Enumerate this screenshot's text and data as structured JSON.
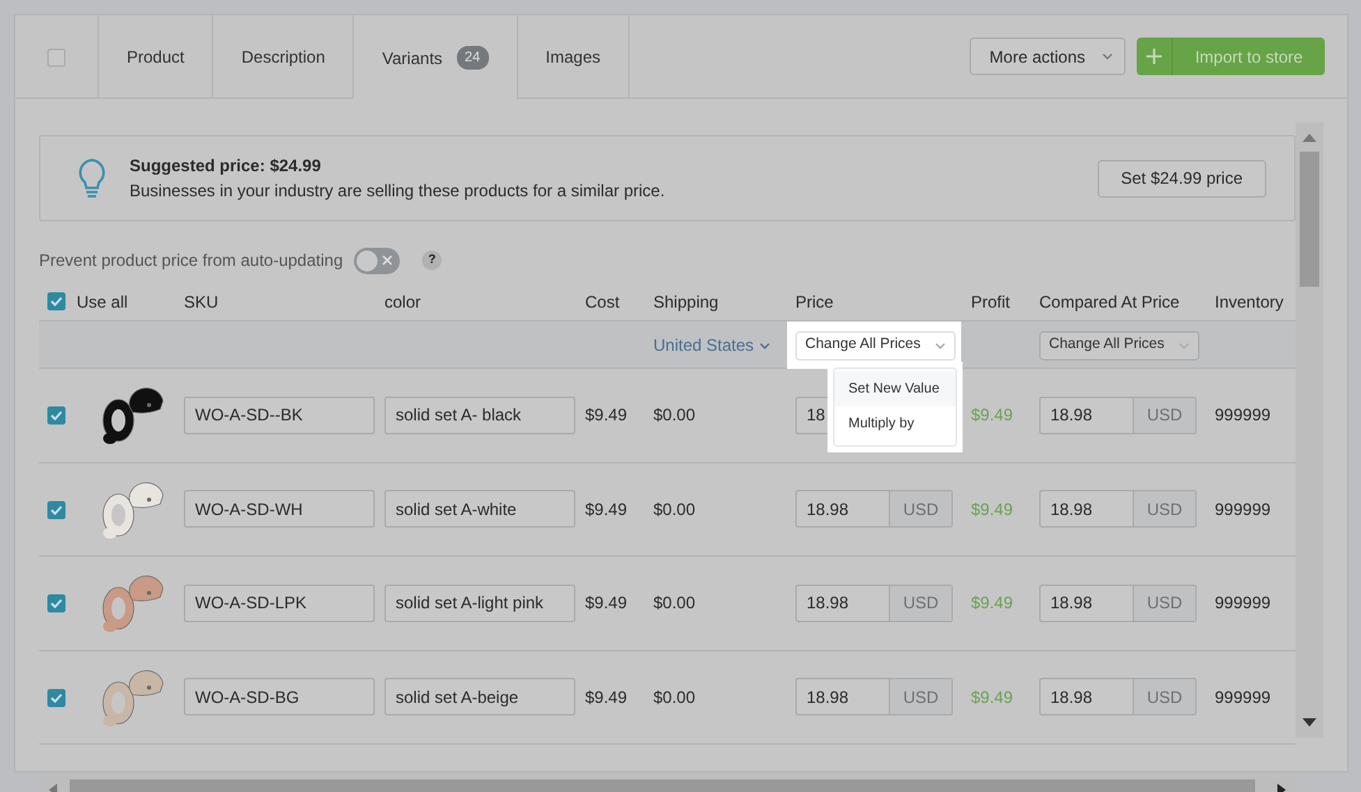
{
  "tabs": [
    {
      "kind": "checkbox",
      "checked": false,
      "selected": false
    },
    {
      "kind": "text",
      "label": "Product",
      "selected": false
    },
    {
      "kind": "text",
      "label": "Description",
      "selected": false
    },
    {
      "kind": "text",
      "label": "Variants",
      "badge": "24",
      "selected": true
    },
    {
      "kind": "text",
      "label": "Images",
      "selected": false
    }
  ],
  "more_actions": "More actions",
  "import_button": "Import to store",
  "suggestion": {
    "title": "Suggested price: $24.99",
    "text": "Businesses in your industry are selling these products for a similar price.",
    "button": "Set $24.99 price"
  },
  "auto_update": {
    "label": "Prevent product price from auto-updating",
    "on": false,
    "help": "?"
  },
  "use_all": {
    "label": "Use all",
    "checked": true
  },
  "columns": [
    "SKU",
    "color",
    "Cost",
    "Shipping",
    "Price",
    "Profit",
    "Compared At Price",
    "Inventory"
  ],
  "shipping_country": "United States",
  "price_change": {
    "label": "Change All Prices",
    "expanded": true,
    "options": [
      {
        "label": "Set New Value",
        "selected": true
      },
      {
        "label": "Multiply by",
        "selected": false
      }
    ]
  },
  "compared_change": {
    "label": "Change All Prices",
    "expanded": false
  },
  "rows": [
    {
      "checked": true,
      "color": "#111111",
      "sku": "WO-A-SD--BK",
      "variant": "solid set A- black",
      "cost": "$9.49",
      "shipping": "$0.00",
      "price": "18",
      "price_currency": null,
      "profit": "$9.49",
      "compared": "18.98",
      "compared_currency": "USD",
      "inventory": "999999"
    },
    {
      "checked": true,
      "color": "#e8e4de",
      "sku": "WO-A-SD-WH",
      "variant": "solid set A-white",
      "cost": "$9.49",
      "shipping": "$0.00",
      "price": "18.98",
      "price_currency": "USD",
      "profit": "$9.49",
      "compared": "18.98",
      "compared_currency": "USD",
      "inventory": "999999"
    },
    {
      "checked": true,
      "color": "#c99a86",
      "sku": "WO-A-SD-LPK",
      "variant": "solid set A-light pink",
      "cost": "$9.49",
      "shipping": "$0.00",
      "price": "18.98",
      "price_currency": "USD",
      "profit": "$9.49",
      "compared": "18.98",
      "compared_currency": "USD",
      "inventory": "999999"
    },
    {
      "checked": true,
      "color": "#c8b6a6",
      "sku": "WO-A-SD-BG",
      "variant": "solid set A-beige",
      "cost": "$9.49",
      "shipping": "$0.00",
      "price": "18.98",
      "price_currency": "USD",
      "profit": "$9.49",
      "compared": "18.98",
      "compared_currency": "USD",
      "inventory": "999999"
    }
  ]
}
